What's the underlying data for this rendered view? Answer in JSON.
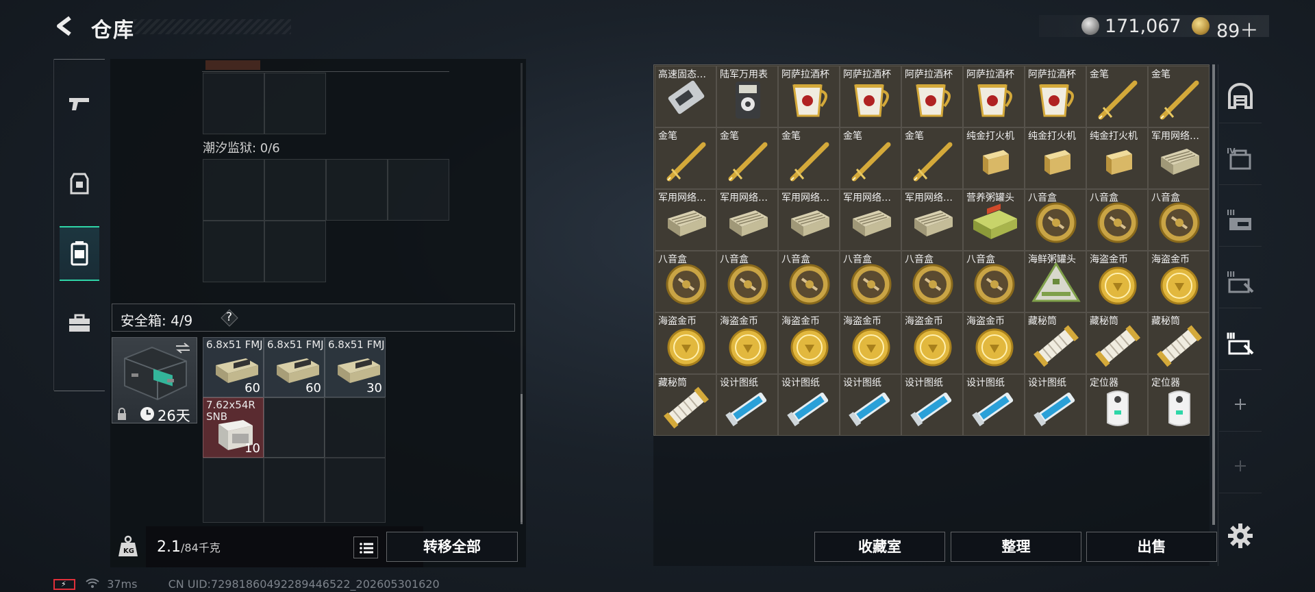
{
  "header": {
    "title": "仓库",
    "currency_silver": "171,067",
    "currency_gold": "89＋"
  },
  "left_nav": [
    {
      "id": "weapons",
      "icon": "pistol-icon"
    },
    {
      "id": "armor",
      "icon": "vest-icon"
    },
    {
      "id": "backpack",
      "icon": "backpack-icon"
    },
    {
      "id": "toolbox",
      "icon": "briefcase-icon"
    }
  ],
  "containers": {
    "tide_prison_label": "潮汐监狱: 0/6",
    "safebox_label": "安全箱: 4/9",
    "safebox_help": "?",
    "safebox_duration": "26天"
  },
  "safebox_items": [
    {
      "name": "6.8x51 FMJ",
      "qty": "60",
      "color": "#464f5b"
    },
    {
      "name": "6.8x51 FMJ",
      "qty": "60",
      "color": "#464f5b"
    },
    {
      "name": "6.8x51 FMJ",
      "qty": "30",
      "color": "#464f5b"
    },
    {
      "name": "7.62x54R SNB",
      "qty": "10",
      "color": "#783238"
    }
  ],
  "footer": {
    "weight_value": "2.1",
    "weight_capacity": "/84千克",
    "transfer_all": "转移全部",
    "status_ping": "37ms",
    "uid": "CN UID:7298186049228944652​2_202605301620"
  },
  "warehouse_items": [
    {
      "name": "高速固态…",
      "icon": "ssd-icon"
    },
    {
      "name": "陆军万用表",
      "icon": "multimeter-icon"
    },
    {
      "name": "阿萨拉酒杯",
      "icon": "cup-icon"
    },
    {
      "name": "阿萨拉酒杯",
      "icon": "cup-icon"
    },
    {
      "name": "阿萨拉酒杯",
      "icon": "cup-icon"
    },
    {
      "name": "阿萨拉酒杯",
      "icon": "cup-icon"
    },
    {
      "name": "阿萨拉酒杯",
      "icon": "cup-icon"
    },
    {
      "name": "金笔",
      "icon": "pen-icon"
    },
    {
      "name": "金笔",
      "icon": "pen-icon"
    },
    {
      "name": "金笔",
      "icon": "pen-icon"
    },
    {
      "name": "金笔",
      "icon": "pen-icon"
    },
    {
      "name": "金笔",
      "icon": "pen-icon"
    },
    {
      "name": "金笔",
      "icon": "pen-icon"
    },
    {
      "name": "金笔",
      "icon": "pen-icon"
    },
    {
      "name": "纯金打火机",
      "icon": "lighter-icon"
    },
    {
      "name": "纯金打火机",
      "icon": "lighter-icon"
    },
    {
      "name": "纯金打火机",
      "icon": "lighter-icon"
    },
    {
      "name": "军用网络…",
      "icon": "network-device-icon"
    },
    {
      "name": "军用网络…",
      "icon": "network-device-icon"
    },
    {
      "name": "军用网络…",
      "icon": "network-device-icon"
    },
    {
      "name": "军用网络…",
      "icon": "network-device-icon"
    },
    {
      "name": "军用网络…",
      "icon": "network-device-icon"
    },
    {
      "name": "军用网络…",
      "icon": "network-device-icon"
    },
    {
      "name": "营养粥罐头",
      "icon": "can-icon"
    },
    {
      "name": "八音盒",
      "icon": "music-box-icon"
    },
    {
      "name": "八音盒",
      "icon": "music-box-icon"
    },
    {
      "name": "八音盒",
      "icon": "music-box-icon"
    },
    {
      "name": "八音盒",
      "icon": "music-box-icon"
    },
    {
      "name": "八音盒",
      "icon": "music-box-icon"
    },
    {
      "name": "八音盒",
      "icon": "music-box-icon"
    },
    {
      "name": "八音盒",
      "icon": "music-box-icon"
    },
    {
      "name": "八音盒",
      "icon": "music-box-icon"
    },
    {
      "name": "八音盒",
      "icon": "music-box-icon"
    },
    {
      "name": "海鲜粥罐头",
      "icon": "triangle-can-icon"
    },
    {
      "name": "海盗金币",
      "icon": "coin-icon"
    },
    {
      "name": "海盗金币",
      "icon": "coin-icon"
    },
    {
      "name": "海盗金币",
      "icon": "coin-icon"
    },
    {
      "name": "海盗金币",
      "icon": "coin-icon"
    },
    {
      "name": "海盗金币",
      "icon": "coin-icon"
    },
    {
      "name": "海盗金币",
      "icon": "coin-icon"
    },
    {
      "name": "海盗金币",
      "icon": "coin-icon"
    },
    {
      "name": "海盗金币",
      "icon": "coin-icon"
    },
    {
      "name": "藏秘筒",
      "icon": "cryptex-icon"
    },
    {
      "name": "藏秘筒",
      "icon": "cryptex-icon"
    },
    {
      "name": "藏秘筒",
      "icon": "cryptex-icon"
    },
    {
      "name": "藏秘筒",
      "icon": "cryptex-icon"
    },
    {
      "name": "设计图纸",
      "icon": "blueprint-icon"
    },
    {
      "name": "设计图纸",
      "icon": "blueprint-icon"
    },
    {
      "name": "设计图纸",
      "icon": "blueprint-icon"
    },
    {
      "name": "设计图纸",
      "icon": "blueprint-icon"
    },
    {
      "name": "设计图纸",
      "icon": "blueprint-icon"
    },
    {
      "name": "设计图纸",
      "icon": "blueprint-icon"
    },
    {
      "name": "定位器",
      "icon": "locator-icon"
    },
    {
      "name": "定位器",
      "icon": "locator-icon"
    }
  ],
  "actions": {
    "collection_room": "收藏室",
    "organize": "整理",
    "sell": "出售"
  },
  "right_tabs": [
    {
      "id": "all",
      "icon": "warehouse-arch-icon",
      "roman": ""
    },
    {
      "id": "iv",
      "icon": "storage-iv-icon",
      "roman": "IV"
    },
    {
      "id": "iii-a",
      "icon": "storage-iii-icon",
      "roman": "III"
    },
    {
      "id": "iii-b",
      "icon": "storage-iii-icon",
      "roman": "III"
    },
    {
      "id": "iii-c",
      "icon": "storage-iii-icon",
      "roman": "III"
    },
    {
      "id": "add",
      "icon": "plus-icon",
      "roman": ""
    },
    {
      "id": "add-disabled",
      "icon": "plus-icon",
      "roman": ""
    }
  ],
  "colors": {
    "accent": "#2fd6a8",
    "item_bg": "#403c34",
    "gold": "#d4a93a"
  }
}
